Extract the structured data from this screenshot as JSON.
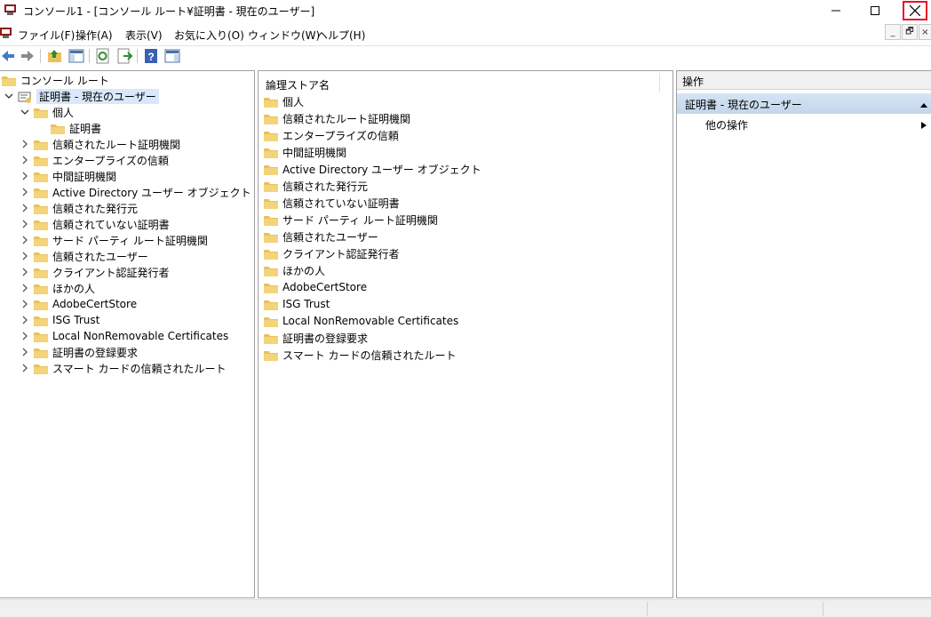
{
  "window": {
    "title": "コンソール1 - [コンソール ルート¥証明書 - 現在のユーザー]",
    "close_color": "#e81123"
  },
  "menu": {
    "items": [
      "ファイル(F)",
      "操作(A)",
      "表示(V)",
      "お気に入り(O)",
      "ウィンドウ(W)",
      "ヘルプ(H)"
    ]
  },
  "toolbar": {
    "icons": [
      "back-arrow-icon",
      "forward-arrow-icon",
      "up-folder-icon",
      "show-hide-tree-icon",
      "refresh-icon",
      "export-list-icon",
      "help-icon",
      "show-hide-action-pane-icon"
    ]
  },
  "tree": {
    "root": "コンソール ルート",
    "store": "証明書 - 現在のユーザー",
    "personal": "個人",
    "personal_child": "証明書",
    "items": [
      "信頼されたルート証明機関",
      "エンタープライズの信頼",
      "中間証明機関",
      "Active Directory ユーザー オブジェクト",
      "信頼された発行元",
      "信頼されていない証明書",
      "サード パーティ ルート証明機関",
      "信頼されたユーザー",
      "クライアント認証発行者",
      "ほかの人",
      "AdobeCertStore",
      "ISG Trust",
      "Local NonRemovable Certificates",
      "証明書の登録要求",
      "スマート カードの信頼されたルート"
    ]
  },
  "list": {
    "column_header": "論理ストア名",
    "items": [
      "個人",
      "信頼されたルート証明機関",
      "エンタープライズの信頼",
      "中間証明機関",
      "Active Directory ユーザー オブジェクト",
      "信頼された発行元",
      "信頼されていない証明書",
      "サード パーティ ルート証明機関",
      "信頼されたユーザー",
      "クライアント認証発行者",
      "ほかの人",
      "AdobeCertStore",
      "ISG Trust",
      "Local NonRemovable Certificates",
      "証明書の登録要求",
      "スマート カードの信頼されたルート"
    ]
  },
  "actions": {
    "title": "操作",
    "section": "証明書 - 現在のユーザー",
    "item": "他の操作"
  }
}
